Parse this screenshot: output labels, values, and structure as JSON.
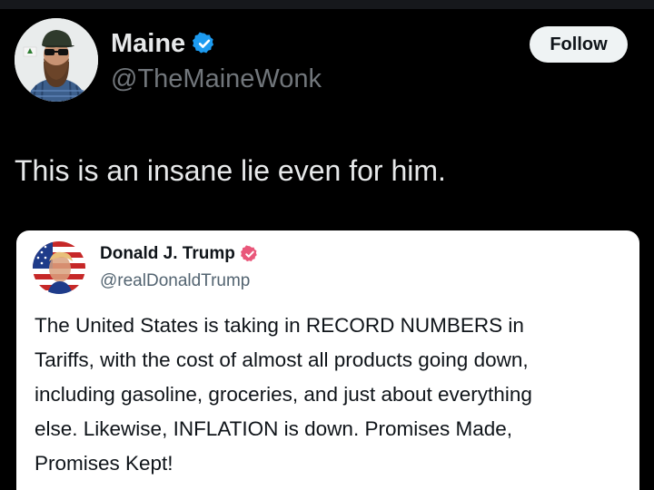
{
  "author": {
    "display_name": "Maine",
    "handle": "@TheMaineWonk",
    "verified": true,
    "avatar_icon": "man-with-sunglasses-and-cap"
  },
  "follow_button": {
    "label": "Follow"
  },
  "tweet": {
    "text": "This is an insane lie even for him."
  },
  "quoted_post": {
    "display_name": "Donald J. Trump",
    "handle": "@realDonaldTrump",
    "verified": true,
    "avatar_icon": "flag-portrait-avatar",
    "body_lines": [
      "The United States is taking in RECORD NUMBERS in",
      "Tariffs, with the cost of almost all products going down,",
      "including gasoline, groceries, and just about everything",
      "else. Likewise, INFLATION is down. Promises Made,",
      "Promises Kept!"
    ]
  },
  "colors": {
    "background": "#000000",
    "primary_text": "#e7e9ea",
    "secondary_text": "#71767b",
    "verified_blue": "#1d9bf0",
    "quote_card_bg": "#ffffff",
    "quote_badge_pink": "#e9577a"
  }
}
